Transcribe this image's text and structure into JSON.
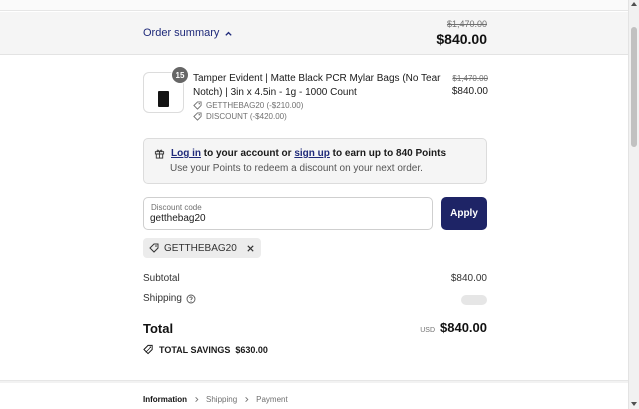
{
  "summary": {
    "toggle_label": "Order summary",
    "compare_total": "$1,470.00",
    "total": "$840.00"
  },
  "line_item": {
    "quantity": "15",
    "title": "Tamper Evident | Matte Black PCR Mylar Bags (No Tear Notch) | 3in x 4.5in - 1g - 1000 Count",
    "discounts": [
      "GETTHEBAG20 (-$210.00)",
      "DISCOUNT (-$420.00)"
    ],
    "compare_price": "$1,470.00",
    "price": "$840.00"
  },
  "rewards": {
    "login_link": "Log in",
    "text_middle": " to your account or ",
    "signup_link": "sign up",
    "text_end": " to earn up to 840 Points",
    "subtext": "Use your Points to redeem a discount on your next order."
  },
  "discount": {
    "label": "Discount code",
    "value": "getthebag20",
    "apply_label": "Apply",
    "applied_code": "GETTHEBAG20"
  },
  "totals": {
    "subtotal_label": "Subtotal",
    "subtotal_value": "$840.00",
    "shipping_label": "Shipping",
    "total_label": "Total",
    "currency": "USD",
    "total_value": "$840.00",
    "savings_label": "TOTAL SAVINGS",
    "savings_value": "$630.00"
  },
  "breadcrumb": {
    "steps": [
      "Information",
      "Shipping",
      "Payment"
    ]
  },
  "colors": {
    "accent": "#1e2466",
    "link": "#1f2a7a"
  }
}
